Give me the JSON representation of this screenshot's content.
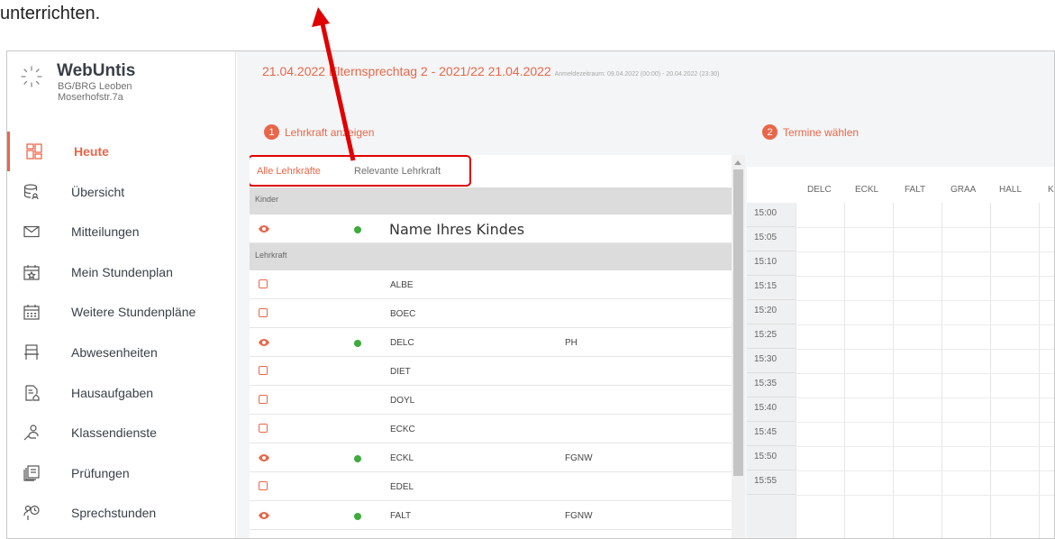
{
  "caption": "unterrichten.",
  "brand": {
    "name": "WebUntis",
    "school_line1": "BG/BRG Leoben",
    "school_line2": "Moserhofstr.7a"
  },
  "nav": {
    "items": [
      {
        "label": "Heute",
        "icon": "dashboard-icon",
        "active": true
      },
      {
        "label": "Übersicht",
        "icon": "overview-icon"
      },
      {
        "label": "Mitteilungen",
        "icon": "envelope-icon"
      },
      {
        "label": "Mein Stundenplan",
        "icon": "calendar-star-icon"
      },
      {
        "label": "Weitere Stundenpläne",
        "icon": "calendar-grid-icon"
      },
      {
        "label": "Abwesenheiten",
        "icon": "absence-icon"
      },
      {
        "label": "Hausaufgaben",
        "icon": "homework-icon"
      },
      {
        "label": "Klassendienste",
        "icon": "class-duty-icon"
      },
      {
        "label": "Prüfungen",
        "icon": "exam-icon"
      },
      {
        "label": "Sprechstunden",
        "icon": "office-hours-icon"
      }
    ]
  },
  "header": {
    "title": "21.04.2022 Elternsprechtag 2 - 2021/22 21.04.2022",
    "registration": "Anmeldezeitraum: 09.04.2022 (00:00) - 20.04.2022 (23:30)"
  },
  "steps": {
    "step1_num": "1",
    "step1_label": "Lehrkraft anzeigen",
    "step2_num": "2",
    "step2_label": "Termine wählen"
  },
  "tabs": {
    "all": "Alle Lehrkräfte",
    "relevant": "Relevante Lehrkraft"
  },
  "sections": {
    "kids": "Kinder",
    "teachers": "Lehrkraft"
  },
  "kid": {
    "name": "Name Ihres Kindes"
  },
  "teachers": [
    {
      "code": "ALBE",
      "subject": "",
      "relevant": false
    },
    {
      "code": "BOEC",
      "subject": "",
      "relevant": false
    },
    {
      "code": "DELC",
      "subject": "PH",
      "relevant": true
    },
    {
      "code": "DIET",
      "subject": "",
      "relevant": false
    },
    {
      "code": "DOYL",
      "subject": "",
      "relevant": false
    },
    {
      "code": "ECKC",
      "subject": "",
      "relevant": false
    },
    {
      "code": "ECKL",
      "subject": "FGNW",
      "relevant": true
    },
    {
      "code": "EDEL",
      "subject": "",
      "relevant": false
    },
    {
      "code": "FALT",
      "subject": "FGNW",
      "relevant": true
    }
  ],
  "schedule": {
    "columns": [
      "DELC",
      "ECKL",
      "FALT",
      "GRAA",
      "HALL",
      "KI"
    ],
    "times": [
      "15:00",
      "15:05",
      "15:10",
      "15:15",
      "15:20",
      "15:25",
      "15:30",
      "15:35",
      "15:40",
      "15:45",
      "15:50",
      "15:55"
    ]
  },
  "colors": {
    "accent": "#e8674a",
    "active_dot": "#3dab3d",
    "annotation_red": "#e00000"
  }
}
